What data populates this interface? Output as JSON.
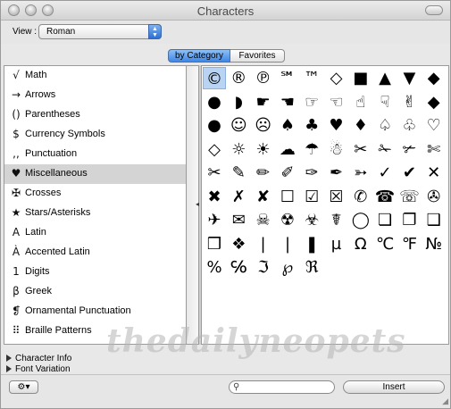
{
  "window": {
    "title": "Characters"
  },
  "toolbar": {
    "view_label": "View :",
    "view_value": "Roman"
  },
  "tabs": [
    {
      "label": "by Category",
      "selected": true
    },
    {
      "label": "Favorites",
      "selected": false
    }
  ],
  "categories": [
    {
      "label": "Math",
      "icon": "√"
    },
    {
      "label": "Arrows",
      "icon": "→"
    },
    {
      "label": "Parentheses",
      "icon": "()"
    },
    {
      "label": "Currency Symbols",
      "icon": "$"
    },
    {
      "label": "Punctuation",
      "icon": ",,"
    },
    {
      "label": "Miscellaneous",
      "icon": "♥",
      "selected": true
    },
    {
      "label": "Crosses",
      "icon": "✠"
    },
    {
      "label": "Stars/Asterisks",
      "icon": "★"
    },
    {
      "label": "Latin",
      "icon": "A"
    },
    {
      "label": "Accented Latin",
      "icon": "À"
    },
    {
      "label": "Digits",
      "icon": "1"
    },
    {
      "label": "Greek",
      "icon": "β"
    },
    {
      "label": "Ornamental Punctuation",
      "icon": "❡"
    },
    {
      "label": "Braille Patterns",
      "icon": "⠿"
    }
  ],
  "glyphs": [
    "©",
    "®",
    "℗",
    "℠",
    "™",
    "◇",
    "■",
    "▲",
    "▼",
    "◆",
    "●",
    "◗",
    "☛",
    "☚",
    "☞",
    "☜",
    "☝",
    "☟",
    "✌",
    "◆",
    "●",
    "☺",
    "☹",
    "♠",
    "♣",
    "♥",
    "♦",
    "♤",
    "♧",
    "♡",
    "◇",
    "☼",
    "☀",
    "☁",
    "☂",
    "☃",
    "✂",
    "✁",
    "✃",
    "✄",
    "✂",
    "✎",
    "✏",
    "✐",
    "✑",
    "✒",
    "➳",
    "✓",
    "✔",
    "✕",
    "✖",
    "✗",
    "✘",
    "☐",
    "☑",
    "☒",
    "✆",
    "☎",
    "☏",
    "✇",
    "✈",
    "✉",
    "☠",
    "☢",
    "☣",
    "☤",
    "◯",
    "❏",
    "❐",
    "❑",
    "❒",
    "❖",
    "|",
    "❘",
    "❚",
    "µ",
    "Ω",
    "℃",
    "℉",
    "№",
    "%",
    "℅",
    "ℑ",
    "℘",
    "ℜ"
  ],
  "info": {
    "character_info": "Character Info",
    "font_variation": "Font Variation"
  },
  "bottom": {
    "search_placeholder": "",
    "insert_label": "Insert",
    "gear_label": "⚙▾"
  },
  "watermark": "thedailyneopets",
  "colors": {
    "selection": "#b9d3f3",
    "accent": "#3f86e6"
  }
}
